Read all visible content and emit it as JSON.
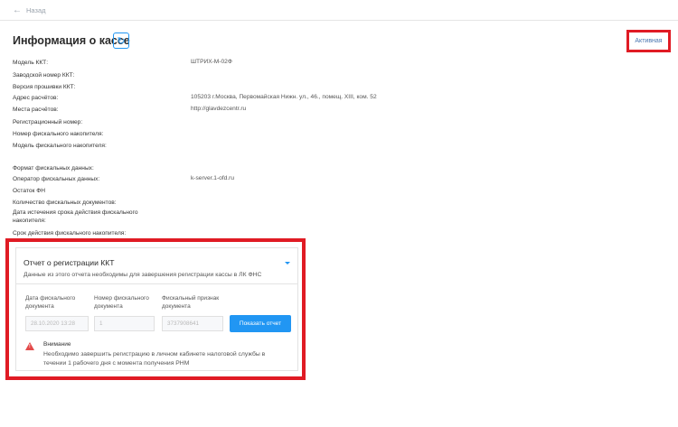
{
  "nav": {
    "back_label": "Назад"
  },
  "header": {
    "title": "Информация о кассе",
    "status": "Активная"
  },
  "info": [
    {
      "label": "Модель ККТ:",
      "value": "ШТРИХ-М-02Ф"
    },
    {
      "label": "Заводской номер ККТ:",
      "value": ""
    },
    {
      "label": "Версия прошивки ККТ:",
      "value": ""
    },
    {
      "label": "Адрес расчётов:",
      "value": "105203 г.Москва, Первомайская Нижн. ул., 46., помещ. XIII, ком. 52"
    },
    {
      "label": "Места расчётов:",
      "value": "http://glavdezcentr.ru"
    },
    {
      "label": "Регистрационный номер:",
      "value": ""
    },
    {
      "label": "Номер фискального накопителя:",
      "value": ""
    },
    {
      "label": "Модель фискального накопителя:",
      "value": ""
    },
    {
      "label": "Формат фискальных данных:",
      "value": ""
    },
    {
      "label": "Оператор фискальных данных:",
      "value": "k-server.1-ofd.ru"
    },
    {
      "label": "Остаток ФН",
      "value": ""
    },
    {
      "label": "Количество фискальных документов:",
      "value": ""
    },
    {
      "label": "Дата истечения срока действия фискального накопителя:",
      "value": ""
    },
    {
      "label": "Срок действия фискального накопителя:",
      "value": ""
    }
  ],
  "report": {
    "title": "Отчет о регистрации ККТ",
    "subtitle": "Данные из этого отчета необходимы для завершения регистрации кассы в ЛК ФНС",
    "fields": [
      {
        "label": "Дата фискального документа",
        "value": "28.10.2020 13:28"
      },
      {
        "label": "Номер фискального документа",
        "value": "1"
      },
      {
        "label": "Фискальный признак документа",
        "value": "3737908641"
      }
    ],
    "button": "Показать отчет",
    "warning_title": "Внимание",
    "warning_text": "Необходимо завершить регистрацию в личном кабинете налоговой службы в течении 1 рабочего дня с момента получения РНМ"
  },
  "colors": {
    "accent": "#2196f3",
    "highlight": "#e01b24",
    "warning": "#e34a4a"
  },
  "icons": [
    "arrow-left-icon",
    "refresh-icon",
    "chevron-down-icon",
    "warning-icon"
  ]
}
